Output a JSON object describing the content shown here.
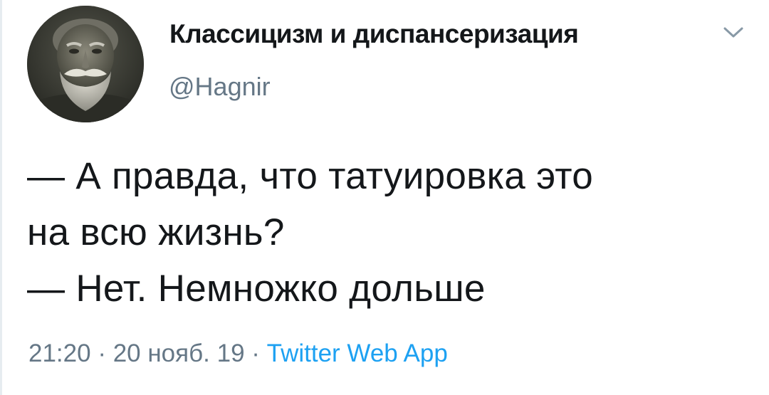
{
  "user": {
    "display_name": "Классицизм и диспансеризация",
    "handle": "@Hagnir"
  },
  "tweet": {
    "lines": [
      "— А правда, что татуировка это",
      "на всю жизнь?",
      "— Нет. Немножко дольше"
    ]
  },
  "meta": {
    "time": "21:20",
    "separator": " · ",
    "date": "20 нояб. 19",
    "source": "Twitter Web App"
  },
  "icons": {
    "menu": "chevron-down-icon",
    "avatar": "bearded-old-man-portrait"
  },
  "colors": {
    "text": "#14171a",
    "secondary": "#657786",
    "link": "#1da1f2"
  }
}
